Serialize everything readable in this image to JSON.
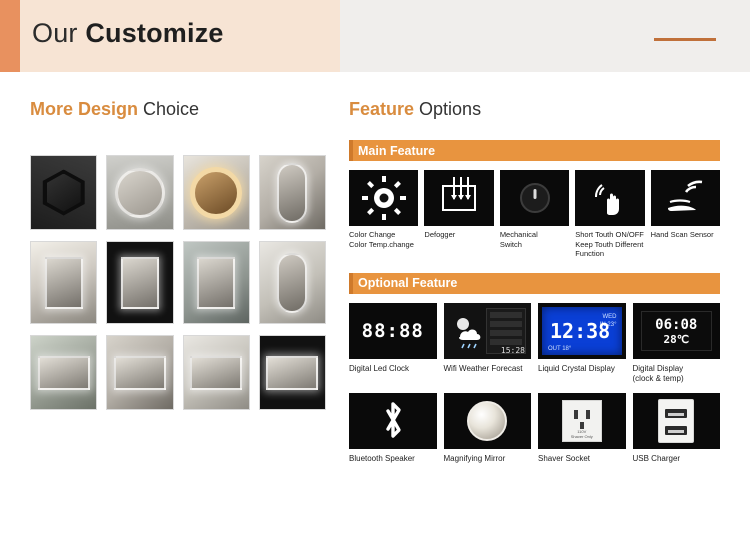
{
  "header": {
    "title_word1": "Our",
    "title_word2": "Customize"
  },
  "left_section": {
    "title_bold": "More Design",
    "title_light": " Choice",
    "rows": [
      {
        "items": [
          "hexagon-black-mirror",
          "round-backlit-mirror",
          "round-warm-led-mirror",
          "oval-led-mirror"
        ]
      },
      {
        "items": [
          "rect-led-mirror-magnifier",
          "black-frame-mirror",
          "rect-backlit-mirror",
          "tall-led-mirror"
        ]
      },
      {
        "items": [
          "wide-led-mirror-1",
          "wide-led-mirror-2",
          "wide-led-mirror-3",
          "wide-black-led-mirror"
        ]
      }
    ]
  },
  "right_section": {
    "title_bold": "Feature",
    "title_light": " Options",
    "main_feature": {
      "bar_label": "Main Feature",
      "items": [
        {
          "icon": "sun-brightness-icon",
          "caption": "Color Change\nColor Temp.change"
        },
        {
          "icon": "defogger-icon",
          "caption": "Defogger"
        },
        {
          "icon": "mechanical-switch-icon",
          "caption": "Mechanical\nSwitch"
        },
        {
          "icon": "touch-sensor-icon",
          "caption": "Short Touth ON/OFF\nKeep Touth Different\nFunction"
        },
        {
          "icon": "hand-scan-sensor-icon",
          "caption": "Hand Scan Sensor"
        }
      ]
    },
    "optional_feature": {
      "bar_label": "Optional Feature",
      "row1": [
        {
          "icon": "digital-led-clock-icon",
          "caption": "Digital Led Clock",
          "display": "88:88"
        },
        {
          "icon": "wifi-weather-forecast-icon",
          "caption": "Wifi Weather Forecast",
          "display": "15:28"
        },
        {
          "icon": "liquid-crystal-display-icon",
          "caption": "Liquid Crystal Display",
          "display": "12:38"
        },
        {
          "icon": "digital-display-icon",
          "caption": "Digital Display\n(clock & temp)",
          "display_time": "06:08",
          "display_temp": "28℃"
        }
      ],
      "row2": [
        {
          "icon": "bluetooth-speaker-icon",
          "caption": "Bluetooth Speaker"
        },
        {
          "icon": "magnifying-mirror-icon",
          "caption": "Magnifying Mirror"
        },
        {
          "icon": "shaver-socket-icon",
          "caption": "Shaver Socket",
          "socket_label": "110V\nShaver Only"
        },
        {
          "icon": "usb-charger-icon",
          "caption": "USB Charger"
        }
      ]
    }
  },
  "colors": {
    "accent_orange": "#e8943f",
    "header_band": "#f0eeec",
    "header_tan": "#f7e4d4",
    "rule": "#c0703a"
  }
}
